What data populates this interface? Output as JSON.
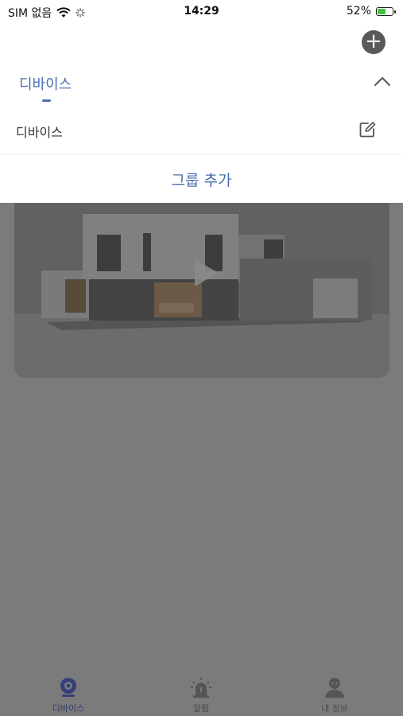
{
  "status_bar": {
    "carrier": "SIM 없음",
    "time": "14:29",
    "battery": "52%"
  },
  "header": {
    "add_icon": "plus-circle-icon"
  },
  "group_section": {
    "active_tab": "디바이스",
    "group_name": "디바이스",
    "collapse_icon": "chevron-up-icon",
    "edit_icon": "edit-icon",
    "add_group_label": "그룹 추가"
  },
  "device_card": {
    "play_icon": "play-icon"
  },
  "tabbar": {
    "items": [
      {
        "label": "디바이스",
        "icon": "camera-icon"
      },
      {
        "label": "알람",
        "icon": "alarm-icon"
      },
      {
        "label": "내 정보",
        "icon": "person-icon"
      }
    ]
  },
  "colors": {
    "accent": "#4a6fae",
    "overlay": "#7b7b7b"
  }
}
